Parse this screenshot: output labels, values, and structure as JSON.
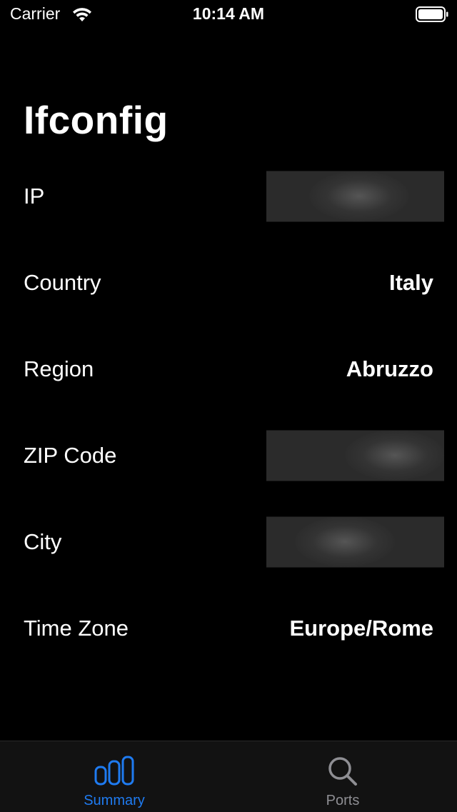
{
  "status_bar": {
    "carrier": "Carrier",
    "time": "10:14 AM",
    "wifi_icon": "wifi-icon",
    "battery_icon": "battery-icon"
  },
  "page": {
    "title": "Ifconfig"
  },
  "rows": [
    {
      "label": "IP",
      "value": null,
      "redacted": true
    },
    {
      "label": "Country",
      "value": "Italy",
      "redacted": false
    },
    {
      "label": "Region",
      "value": "Abruzzo",
      "redacted": false
    },
    {
      "label": "ZIP Code",
      "value": null,
      "redacted": true
    },
    {
      "label": "City",
      "value": null,
      "redacted": true
    },
    {
      "label": "Time Zone",
      "value": "Europe/Rome",
      "redacted": false
    }
  ],
  "tab_bar": {
    "tabs": [
      {
        "label": "Summary",
        "icon": "chart-bar-icon",
        "active": true
      },
      {
        "label": "Ports",
        "icon": "search-icon",
        "active": false
      }
    ]
  },
  "colors": {
    "background": "#000000",
    "accent": "#1f7bf0",
    "inactive": "#8e8e93",
    "tab_bar_bg": "#121212",
    "redacted_bg": "#2b2b2b"
  }
}
